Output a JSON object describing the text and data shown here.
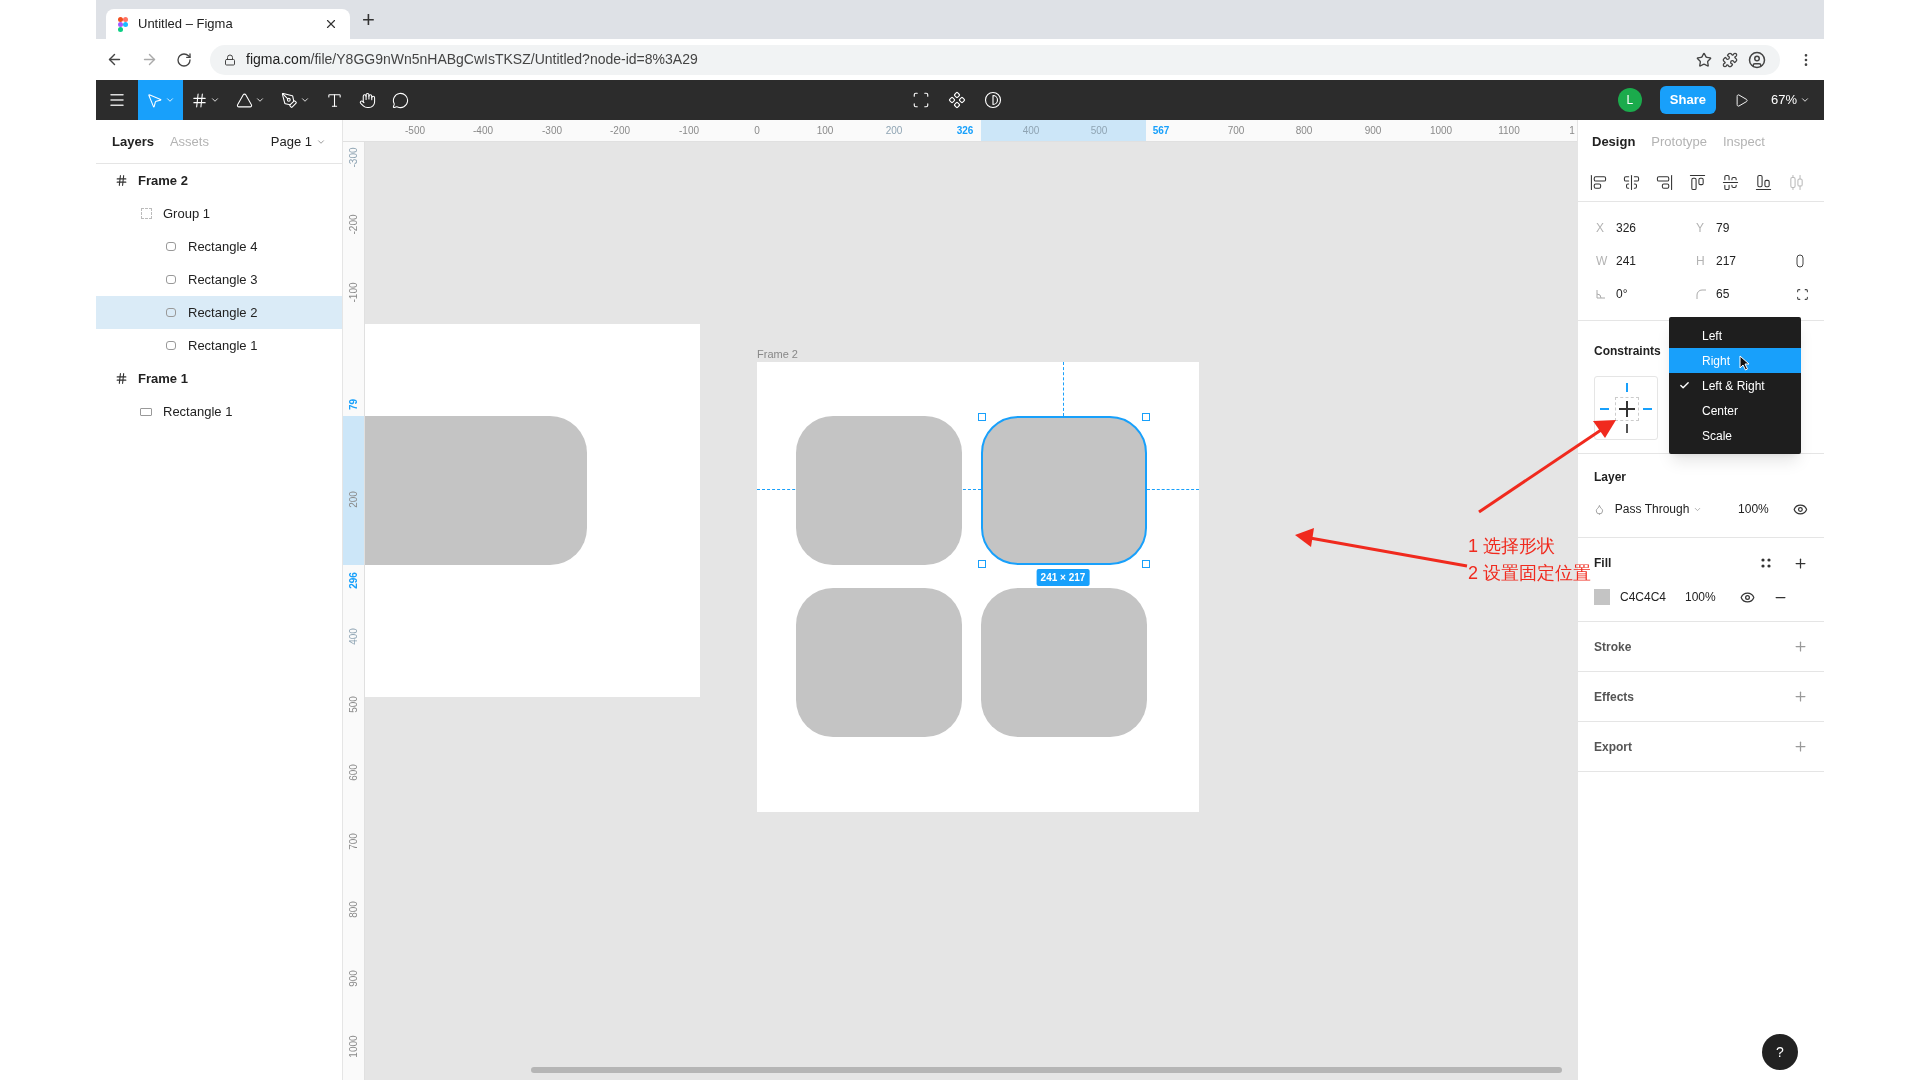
{
  "browser": {
    "tab_title": "Untitled – Figma",
    "new_tab": "+",
    "url_domain": "figma.com",
    "url_path": "/file/Y8GG9nWn5nHABgCwIsTKSZ/Untitled?node-id=8%3A29"
  },
  "toolbar": {
    "tools": [
      {
        "kind": "move",
        "selected": true,
        "menu": true
      },
      {
        "kind": "frame",
        "selected": false,
        "menu": true
      },
      {
        "kind": "shape",
        "selected": false,
        "menu": true
      },
      {
        "kind": "pen",
        "selected": false,
        "menu": true
      },
      {
        "kind": "text",
        "selected": false,
        "menu": false
      },
      {
        "kind": "hand",
        "selected": false,
        "menu": false
      },
      {
        "kind": "comment",
        "selected": false,
        "menu": false
      }
    ],
    "avatar": "L",
    "share": "Share",
    "zoom": "67%"
  },
  "left_panel": {
    "tabs": [
      {
        "label": "Layers",
        "selected": true
      },
      {
        "label": "Assets",
        "selected": false
      }
    ],
    "page": "Page 1",
    "layers": [
      {
        "name": "Frame 2",
        "kind": "frame",
        "selected": false,
        "children": [
          {
            "name": "Group 1",
            "kind": "group",
            "selected": false,
            "children": [
              {
                "name": "Rectangle 4",
                "kind": "rounded",
                "selected": false
              },
              {
                "name": "Rectangle 3",
                "kind": "rounded",
                "selected": false
              },
              {
                "name": "Rectangle 2",
                "kind": "rounded",
                "selected": true
              },
              {
                "name": "Rectangle 1",
                "kind": "rounded",
                "selected": false
              }
            ]
          }
        ]
      },
      {
        "name": "Frame 1",
        "kind": "frame",
        "selected": false,
        "children": [
          {
            "name": "Rectangle 1",
            "kind": "rectangle",
            "selected": false
          }
        ]
      }
    ]
  },
  "rulers": {
    "horizontal": [
      {
        "label": "-500",
        "kind": "tick"
      },
      {
        "label": "-400",
        "kind": "tick"
      },
      {
        "label": "-300",
        "kind": "tick"
      },
      {
        "label": "-200",
        "kind": "tick"
      },
      {
        "label": "-100",
        "kind": "tick"
      },
      {
        "label": "0",
        "kind": "tick"
      },
      {
        "label": "100",
        "kind": "tick"
      },
      {
        "label": "200",
        "kind": "faint"
      },
      {
        "label": "326",
        "kind": "marker"
      },
      {
        "label": "400",
        "kind": "faint"
      },
      {
        "label": "500",
        "kind": "faint"
      },
      {
        "label": "567",
        "kind": "marker"
      },
      {
        "label": "700",
        "kind": "tick"
      },
      {
        "label": "800",
        "kind": "tick"
      },
      {
        "label": "900",
        "kind": "tick"
      },
      {
        "label": "1000",
        "kind": "tick"
      },
      {
        "label": "1100",
        "kind": "tick"
      },
      {
        "label": "1",
        "kind": "tick"
      }
    ],
    "vertical": [
      {
        "label": "-300",
        "kind": "faint"
      },
      {
        "label": "-200",
        "kind": "tick"
      },
      {
        "label": "-100",
        "kind": "tick"
      },
      {
        "label": "79",
        "kind": "marker"
      },
      {
        "label": "200",
        "kind": "tick"
      },
      {
        "label": "296",
        "kind": "marker"
      },
      {
        "label": "400",
        "kind": "faint"
      },
      {
        "label": "500",
        "kind": "tick"
      },
      {
        "label": "600",
        "kind": "tick"
      },
      {
        "label": "700",
        "kind": "tick"
      },
      {
        "label": "800",
        "kind": "tick"
      },
      {
        "label": "900",
        "kind": "tick"
      },
      {
        "label": "1000",
        "kind": "tick"
      }
    ]
  },
  "canvas": {
    "frame_label": "Frame 2",
    "shapes": [
      {
        "selected": false
      },
      {
        "selected": true
      },
      {
        "selected": false
      },
      {
        "selected": false
      }
    ],
    "size_badge": "241 × 217"
  },
  "design_panel": {
    "tabs": [
      {
        "label": "Design",
        "selected": true
      },
      {
        "label": "Prototype",
        "selected": false
      },
      {
        "label": "Inspect",
        "selected": false
      }
    ],
    "fields": [
      {
        "kind": "letter",
        "label": "X",
        "value": "326"
      },
      {
        "kind": "letter",
        "label": "Y",
        "value": "79"
      },
      {
        "kind": "letter",
        "label": "W",
        "value": "241"
      },
      {
        "kind": "letter",
        "label": "H",
        "value": "217"
      },
      {
        "kind": "rotation",
        "value": "0°"
      },
      {
        "kind": "radius",
        "value": "65"
      }
    ],
    "constraints": {
      "title": "Constraints",
      "menu": [
        {
          "label": "Left",
          "selected": false,
          "checked": false
        },
        {
          "label": "Right",
          "selected": true,
          "checked": false
        },
        {
          "label": "Left & Right",
          "selected": false,
          "checked": true
        },
        {
          "label": "Center",
          "selected": false,
          "checked": false
        },
        {
          "label": "Scale",
          "selected": false,
          "checked": false
        }
      ]
    },
    "layer": {
      "title": "Layer",
      "blend": "Pass Through",
      "opacity": "100%"
    },
    "fill": {
      "title": "Fill",
      "items": [
        {
          "hex": "C4C4C4",
          "color": "#c4c4c4",
          "opacity": "100%"
        }
      ]
    },
    "sections": [
      {
        "title": "Stroke"
      },
      {
        "title": "Effects"
      },
      {
        "title": "Export"
      }
    ],
    "help": "?"
  },
  "annotation": {
    "lines": [
      "1 选择形状",
      "2 设置固定位置"
    ]
  }
}
